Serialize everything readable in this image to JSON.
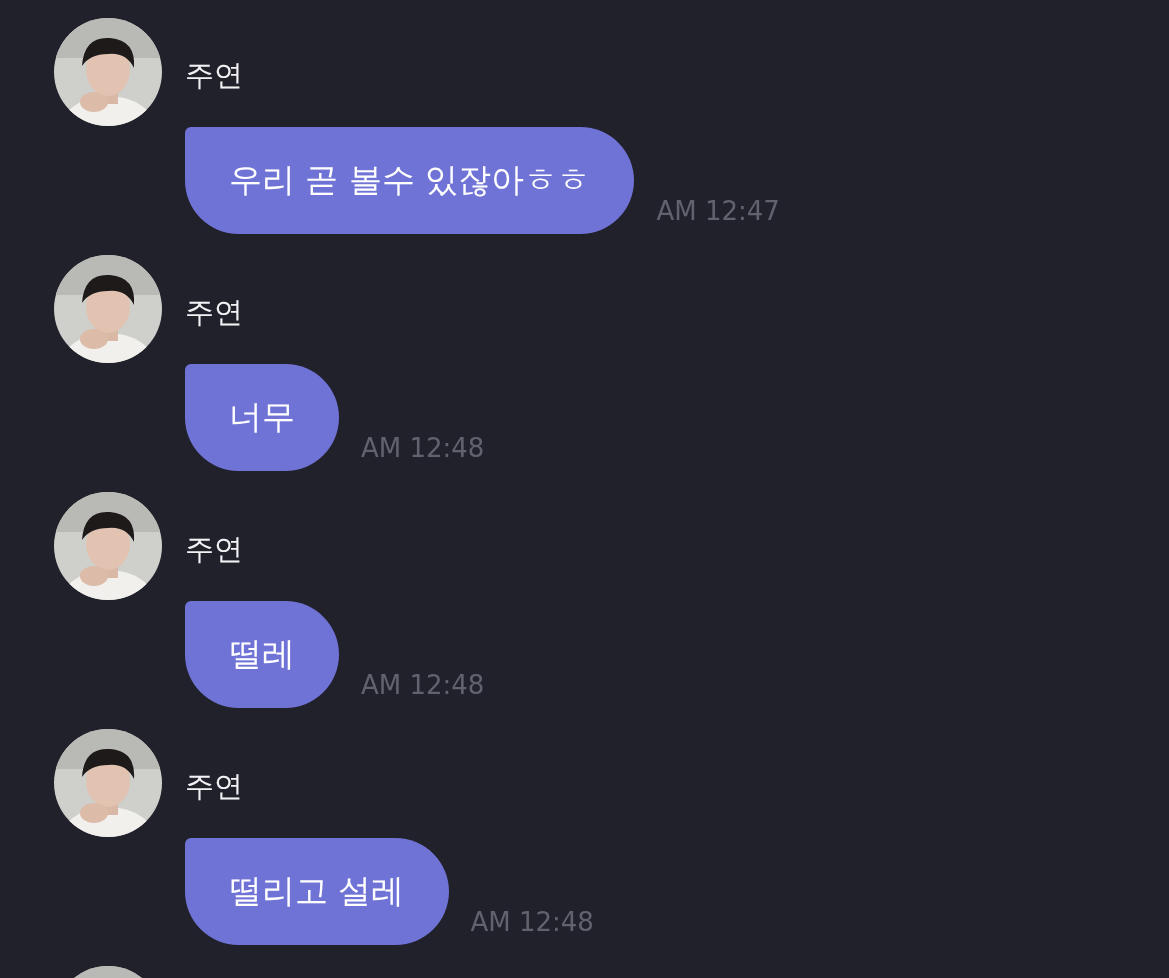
{
  "messages": [
    {
      "sender": "주연",
      "text": "우리 곧 볼수 있잖아ㅎㅎ",
      "time": "AM 12:47"
    },
    {
      "sender": "주연",
      "text": "너무",
      "time": "AM 12:48"
    },
    {
      "sender": "주연",
      "text": "떨레",
      "time": "AM 12:48"
    },
    {
      "sender": "주연",
      "text": "떨리고 설레",
      "time": "AM 12:48"
    }
  ],
  "more_below": true
}
